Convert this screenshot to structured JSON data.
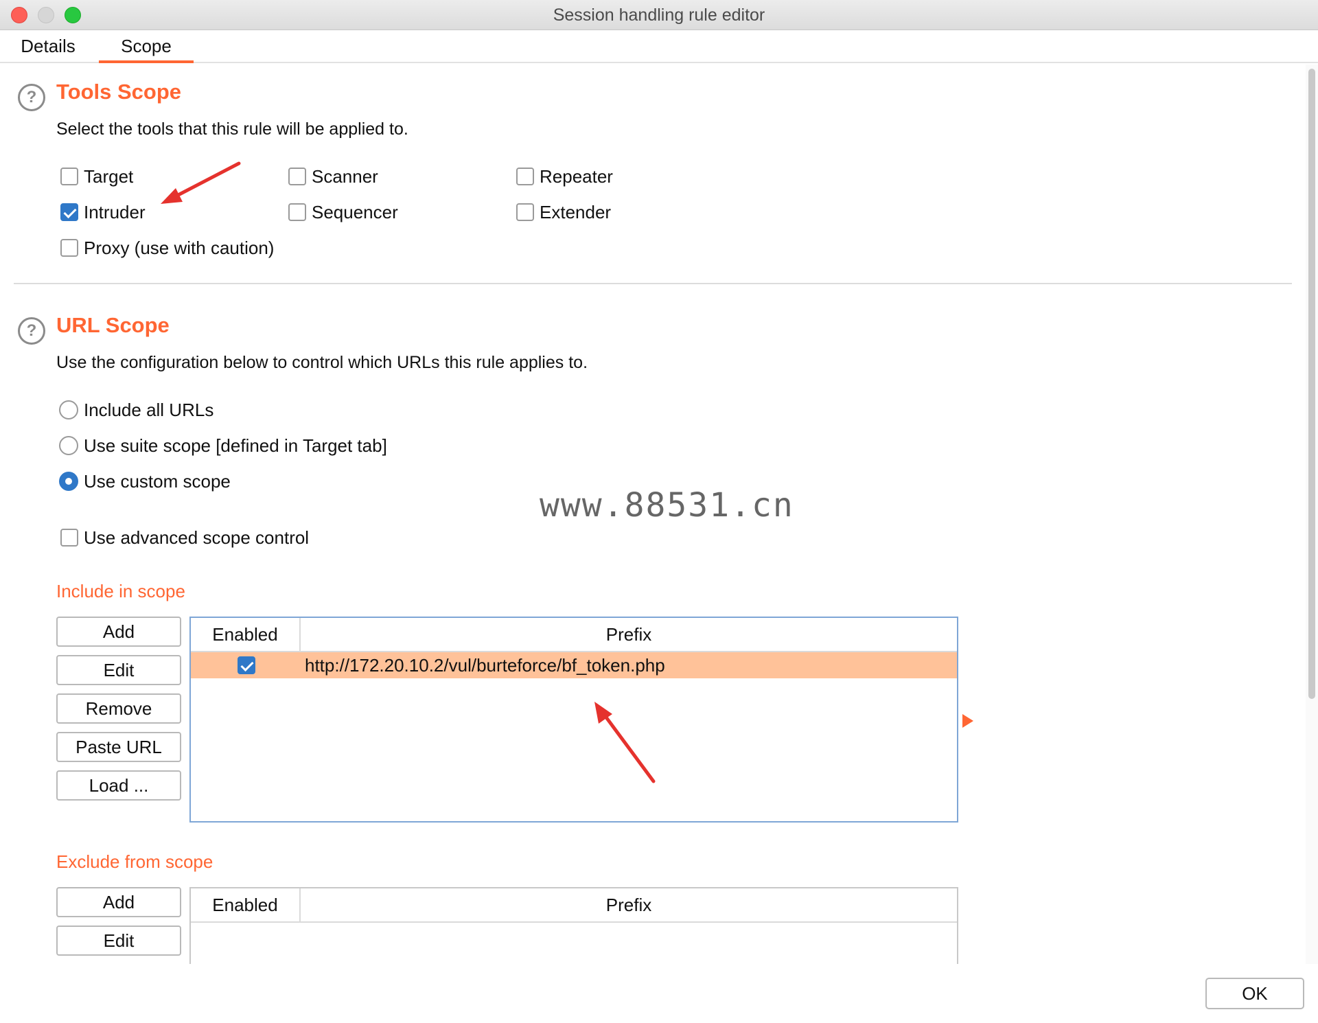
{
  "window": {
    "title": "Session handling rule editor"
  },
  "tabs": [
    {
      "label": "Details"
    },
    {
      "label": "Scope"
    }
  ],
  "tools_scope": {
    "heading": "Tools Scope",
    "description": "Select the tools that this rule will be applied to.",
    "tools": [
      {
        "label": "Target",
        "checked": false
      },
      {
        "label": "Intruder",
        "checked": true
      },
      {
        "label": "Proxy (use with caution)",
        "checked": false
      },
      {
        "label": "Scanner",
        "checked": false
      },
      {
        "label": "Sequencer",
        "checked": false
      },
      {
        "label": "Repeater",
        "checked": false
      },
      {
        "label": "Extender",
        "checked": false
      }
    ]
  },
  "url_scope": {
    "heading": "URL Scope",
    "description": "Use the configuration below to control which URLs this rule applies to.",
    "options": [
      {
        "label": "Include all URLs",
        "selected": false
      },
      {
        "label": "Use suite scope [defined in Target tab]",
        "selected": false
      },
      {
        "label": "Use custom scope",
        "selected": true
      }
    ],
    "advanced": {
      "label": "Use advanced scope control",
      "checked": false
    }
  },
  "include": {
    "heading": "Include in scope",
    "buttons": {
      "add": "Add",
      "edit": "Edit",
      "remove": "Remove",
      "paste": "Paste URL",
      "load": "Load ..."
    },
    "columns": {
      "enabled": "Enabled",
      "prefix": "Prefix"
    },
    "rows": [
      {
        "enabled": true,
        "prefix": "http://172.20.10.2/vul/burteforce/bf_token.php"
      }
    ]
  },
  "exclude": {
    "heading": "Exclude from scope",
    "buttons": {
      "add": "Add",
      "edit": "Edit"
    },
    "columns": {
      "enabled": "Enabled",
      "prefix": "Prefix"
    },
    "rows": []
  },
  "watermark": "www.88531.cn",
  "footer": {
    "ok": "OK"
  },
  "colors": {
    "accent": "#ff6633",
    "check_blue": "#2f78c8",
    "selected_row": "#ffc299",
    "annotation_arrow": "#e5322d"
  },
  "icons": {
    "help": "question-circle-icon",
    "expand": "triangle-right-icon"
  }
}
